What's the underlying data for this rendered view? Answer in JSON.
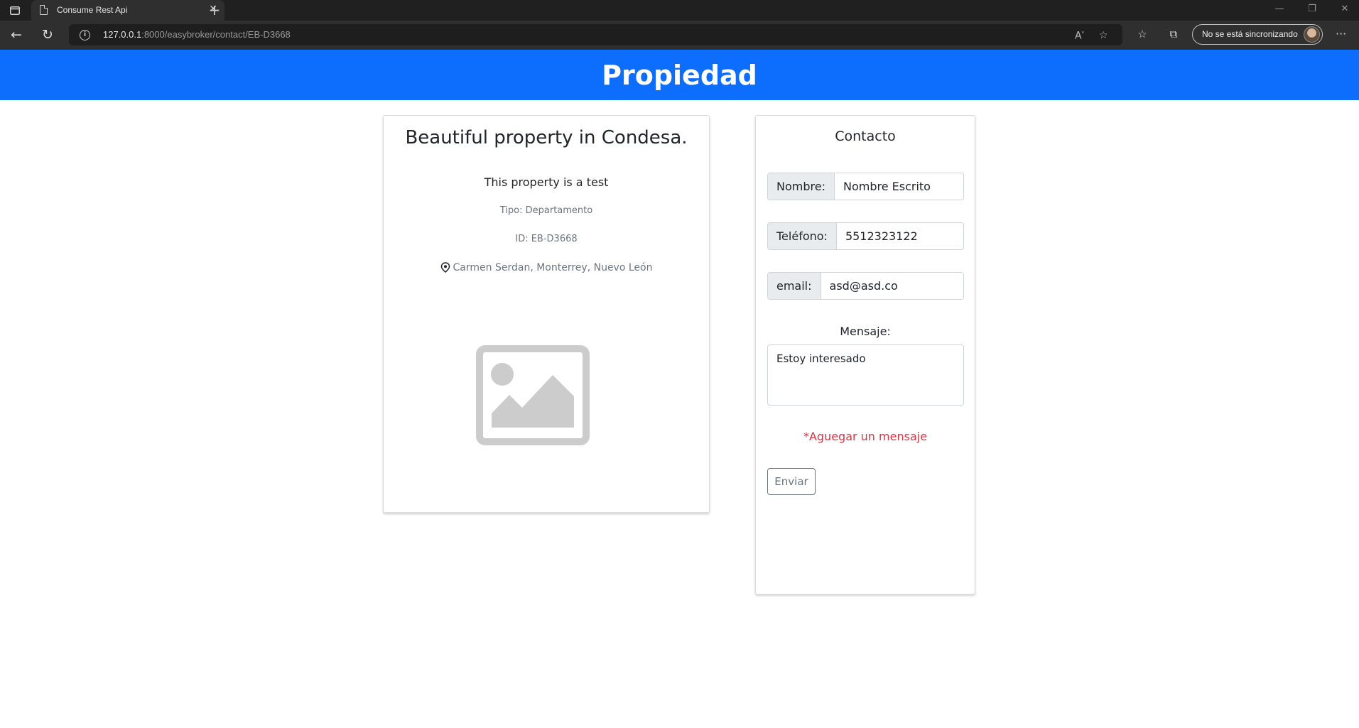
{
  "browser": {
    "tab_title": "Consume Rest Api",
    "url_host": "127.0.0.1",
    "url_path": ":8000/easybroker/contact/EB-D3668",
    "sync_label": "No se está sincronizando"
  },
  "header": {
    "title": "Propiedad"
  },
  "property": {
    "title": "Beautiful property in Condesa.",
    "description": "This property is a test",
    "type": "Tipo: Departamento",
    "id": "ID: EB-D3668",
    "location": "Carmen Serdan, Monterrey, Nuevo León"
  },
  "contact": {
    "title": "Contacto",
    "name_label": "Nombre:",
    "name_value": "Nombre Escrito",
    "phone_label": "Teléfono:",
    "phone_value": "5512323122",
    "email_label": "email:",
    "email_value": "asd@asd.co",
    "message_label": "Mensaje:",
    "message_value": "Estoy interesado",
    "warning": "*Aguegar un mensaje",
    "send_label": "Enviar"
  },
  "colors": {
    "header_bg": "#0d6efd",
    "warning": "#dc3545"
  }
}
